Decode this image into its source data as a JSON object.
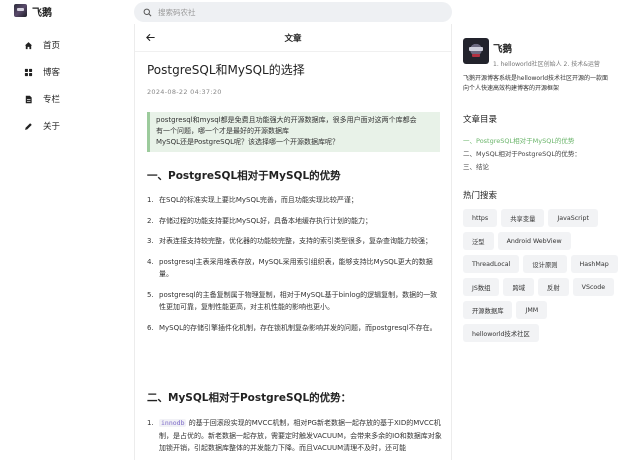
{
  "header": {
    "brand": "飞鹅",
    "search_placeholder": "搜索码农社"
  },
  "nav": {
    "items": [
      {
        "label": "首页",
        "icon": "home-icon"
      },
      {
        "label": "博客",
        "icon": "grid-icon"
      },
      {
        "label": "专栏",
        "icon": "document-icon"
      },
      {
        "label": "关于",
        "icon": "pen-icon"
      }
    ]
  },
  "article": {
    "header_title": "文章",
    "title": "PostgreSQL和MySQL的选择",
    "date": "2024-08-22 04:37:20",
    "quote_line1": "postgresql和mysql都是免费且功能强大的开源数据库，很多用户面对这两个库都会",
    "quote_line2": "有一个问题，哪一个才是最好的开源数据库",
    "quote_line3": "MySQL还是PostgreSQL呢？该选择哪一个开源数据库呢？",
    "section1_title": "一、PostgreSQL相对于MySQL的优势",
    "section1_items": [
      {
        "num": "1.",
        "text": "在SQL的标准实现上要比MySQL完善，而且功能实现比较严谨；"
      },
      {
        "num": "2.",
        "text": "存储过程的功能支持要比MySQL好，具备本地缓存执行计划的能力；"
      },
      {
        "num": "3.",
        "text": "对表连接支持较完整，优化器的功能较完整，支持的索引类型很多，复杂查询能力较强；"
      },
      {
        "num": "4.",
        "text": "postgresql主表采用堆表存放，MySQL采用索引组织表，能够支持比MySQL更大的数据量。"
      },
      {
        "num": "5.",
        "text": "postgresql的主备复制属于物理复制，相对于MySQL基于binlog的逻辑复制，数据的一致性更加可靠，复制性能更高，对主机性能的影响也更小。"
      },
      {
        "num": "6.",
        "text": "MySQL的存储引擎插件化机制，存在锁机制复杂影响并发的问题，而postgresql不存在。"
      }
    ],
    "section2_title": "二、MySQL相对于PostgreSQL的优势：",
    "section2_item1_num": "1.",
    "section2_item1_code": "innodb",
    "section2_item1_text": " 的基于回滚段实现的MVCC机制，相对PG新老数据一起存放的基于XID的MVCC机制，是占优的。新老数据一起存放，需要定时触发VACUUM，会带来多余的IO和数据库对象加锁开销，引起数据库整体的并发能力下降。而且VACUUM清理不及时，还可能"
  },
  "sidebar": {
    "user_name": "飞鹅",
    "user_tag": "1. helloworld社区创始人 2. 技术&运营",
    "user_desc": "飞鹅开源博客系统是helloworld技术社区开源的一款面向个人快速高效构建博客的开源框架",
    "toc_title": "文章目录",
    "toc": [
      {
        "label": "一、PostgreSQL相对于MySQL的优势",
        "active": true
      },
      {
        "label": "二、MySQL相对于PostgreSQL的优势：",
        "active": false
      },
      {
        "label": "三、结论",
        "active": false
      }
    ],
    "tags_title": "热门搜索",
    "tags": [
      "https",
      "共享变量",
      "JavaScript",
      "泛型",
      "Android WebView",
      "ThreadLocal",
      "设计原则",
      "HashMap",
      "JS数组",
      "跨域",
      "反射",
      "VScode",
      "开源数据库",
      "JMM",
      "helloworld技术社区"
    ]
  },
  "colors": {
    "accent_green": "#6bb56b",
    "quote_bg": "#e8f2e8",
    "quote_border": "#9ccb9c",
    "search_bg": "#eef0f3",
    "tag_bg": "#f2f3f5"
  }
}
